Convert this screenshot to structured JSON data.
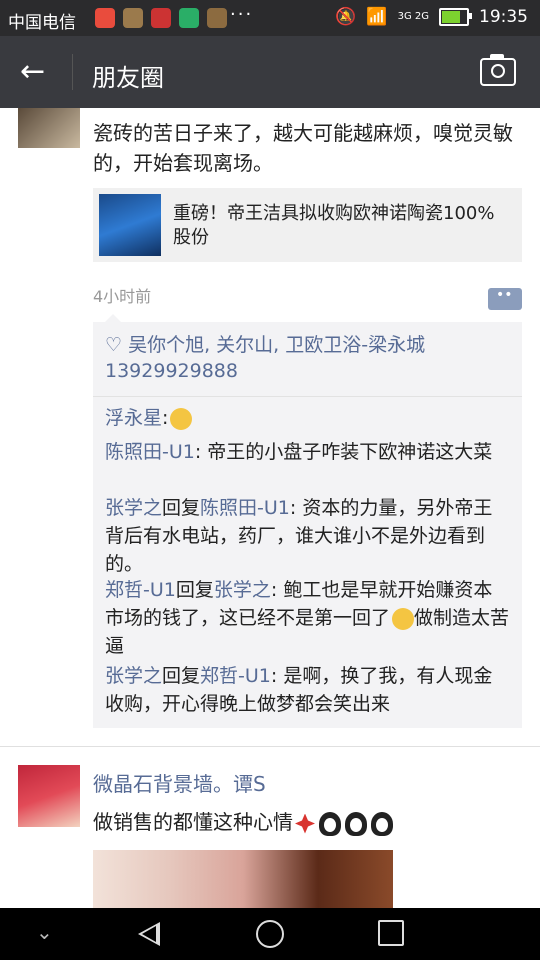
{
  "status_bar": {
    "carrier": "中国电信",
    "dots": "···",
    "network_label": "3G 2G",
    "time": "19:35",
    "battery_level": 0.7
  },
  "header": {
    "title": "朋友圈"
  },
  "post1": {
    "author_name": "",
    "text": "瓷砖的苦日子来了，越大可能越麻烦，嗅觉灵敏的，开始套现离场。",
    "link_title": "重磅！帝王洁具拟收购欧神诺陶瓷100%股份",
    "time": "4小时前",
    "likes": "♡ 吴你个旭, 关尔山, 卫欧卫浴-梁永城 13929929888",
    "comments": [
      {
        "name": "浮永星",
        "reply_to": "",
        "text": ":"
      },
      {
        "name": "陈照田-U1",
        "reply_to": "",
        "text": ": 帝王的小盘子咋装下欧神诺这大菜"
      },
      {
        "name": "张学之",
        "reply_to": "陈照田-U1",
        "text": ": 资本的力量，另外帝王背后有水电站，药厂，谁大谁小不是外边看到的。"
      },
      {
        "name": "郑哲-U1",
        "reply_to": "张学之",
        "text": ": 鲍工也是早就开始赚资本市场的钱了，这已经不是第一回了",
        "text_after": "做制造太苦逼"
      },
      {
        "name": "张学之",
        "reply_to": "郑哲-U1",
        "text": ": 是啊，换了我，有人现金收购，开心得晚上做梦都会笑出来"
      }
    ],
    "reply_word": "回复"
  },
  "post2": {
    "author_name": "微晶石背景墙。谭S",
    "text": "做销售的都懂这种心情"
  }
}
